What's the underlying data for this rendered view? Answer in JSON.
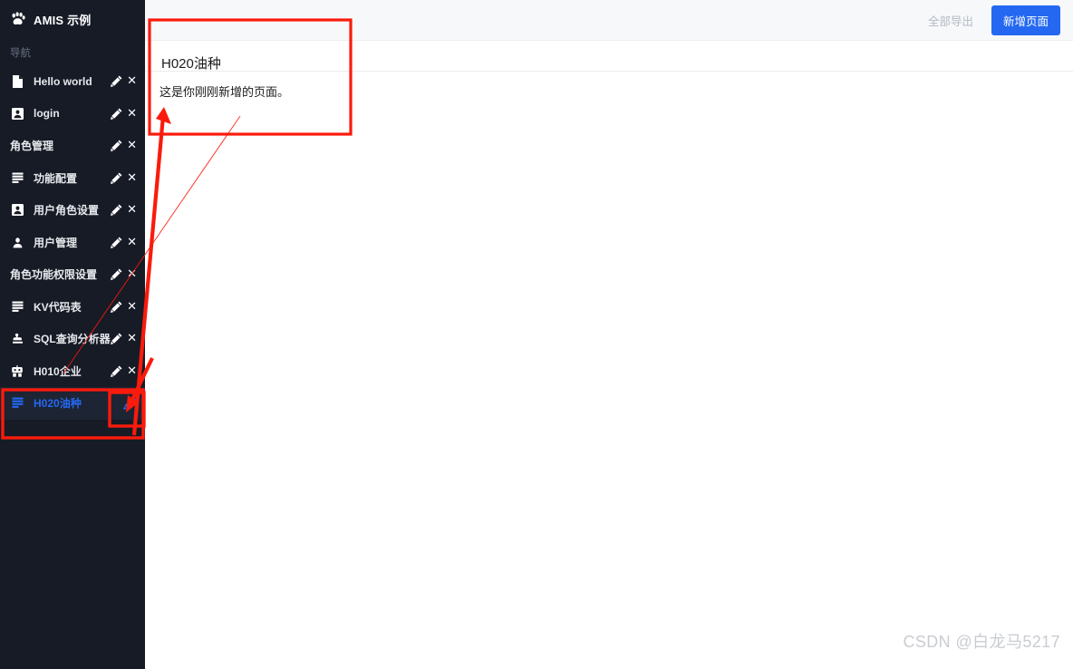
{
  "app": {
    "brand": "AMIS 示例",
    "brand_icon": "paw-icon",
    "sidebar_bg": "#161b26",
    "accent": "#2468f2",
    "annotation_color": "#fa1b0c"
  },
  "sidebar": {
    "nav_title": "导航",
    "items": [
      {
        "label": "Hello world",
        "icon": "file-icon",
        "type": "item",
        "active": false
      },
      {
        "label": "login",
        "icon": "user-box-icon",
        "type": "item",
        "active": false
      },
      {
        "label": "角色管理",
        "icon": "",
        "type": "group",
        "active": false
      },
      {
        "label": "功能配置",
        "icon": "list-lines-icon",
        "type": "item",
        "active": false
      },
      {
        "label": "用户角色设置",
        "icon": "user-box-icon",
        "type": "item",
        "active": false
      },
      {
        "label": "用户管理",
        "icon": "user-icon",
        "type": "item",
        "active": false
      },
      {
        "label": "角色功能权限设置",
        "icon": "",
        "type": "group",
        "active": false
      },
      {
        "label": "KV代码表",
        "icon": "list-lines-icon",
        "type": "item",
        "active": false
      },
      {
        "label": "SQL查询分析器",
        "icon": "stamp-icon",
        "type": "item",
        "active": false
      },
      {
        "label": "H010企业",
        "icon": "robot-icon",
        "type": "item",
        "active": false
      },
      {
        "label": "H020油种",
        "icon": "list-lines-icon",
        "type": "item",
        "active": true
      }
    ],
    "edit_icon": "pencil-icon",
    "delete_icon": "close-icon"
  },
  "topbar": {
    "export_all_label": "全部导出",
    "new_page_label": "新增页面"
  },
  "main": {
    "page_title": "H020油种",
    "page_body": "这是你刚刚新增的页面。"
  },
  "watermark": {
    "text": "CSDN @白龙马5217"
  }
}
